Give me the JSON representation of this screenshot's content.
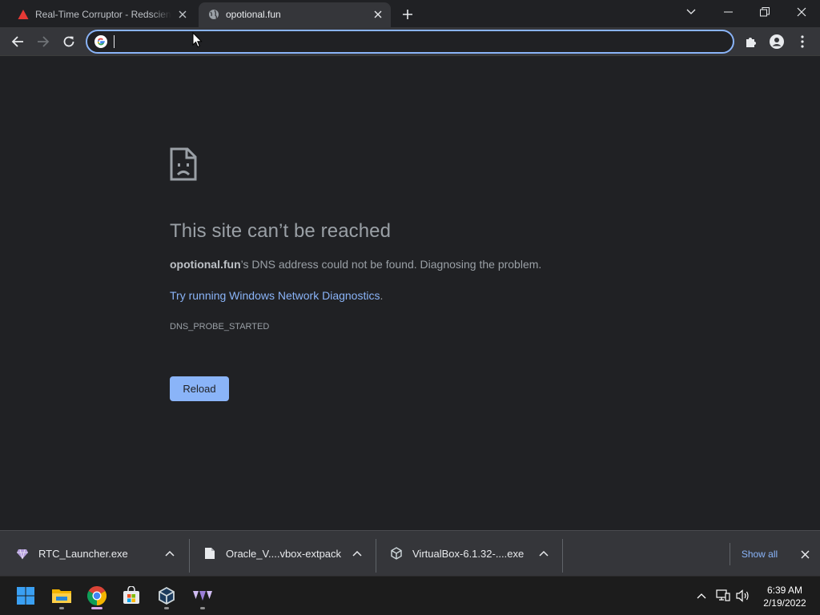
{
  "browser": {
    "tabs": [
      {
        "title": "Real-Time Corruptor - Redscientist",
        "favicon": "red-triangle-icon",
        "active": false
      },
      {
        "title": "opotional.fun",
        "favicon": "globe-icon",
        "active": true
      }
    ],
    "omnibox": {
      "value": "",
      "placeholder": ""
    }
  },
  "error_page": {
    "title": "This site can’t be reached",
    "host": "opotional.fun",
    "description_rest": "’s DNS address could not be found. Diagnosing the problem.",
    "diagnostics_link": "Try running Windows Network Diagnostics",
    "diagnostics_period": ".",
    "error_code": "DNS_PROBE_STARTED",
    "reload_label": "Reload"
  },
  "downloads": {
    "items": [
      {
        "name": "RTC_Launcher.exe",
        "icon": "rtc-launcher-icon"
      },
      {
        "name": "Oracle_V....vbox-extpack",
        "icon": "file-icon"
      },
      {
        "name": "VirtualBox-6.1.32-....exe",
        "icon": "virtualbox-icon"
      }
    ],
    "show_all_label": "Show all"
  },
  "taskbar": {
    "apps": [
      "start-icon",
      "file-explorer-icon",
      "chrome-icon",
      "microsoft-store-icon",
      "virtualbox-icon",
      "rtc-icon"
    ],
    "clock": {
      "time": "6:39 AM",
      "date": "2/19/2022"
    }
  },
  "colors": {
    "accent": "#8ab4f8",
    "page_bg": "#202124",
    "toolbar_bg": "#35363a",
    "taskbar_bg": "#1c1c1c"
  }
}
